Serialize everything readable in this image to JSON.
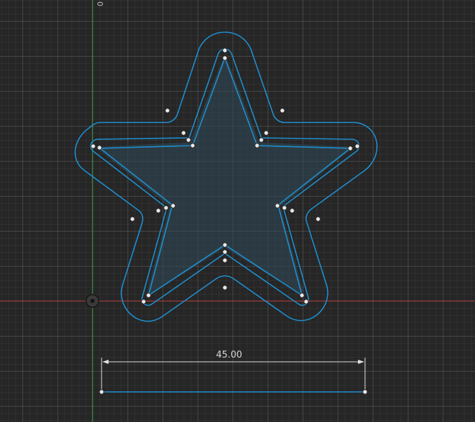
{
  "viewport": {
    "origin_label": "0",
    "colors": {
      "background": "#262626",
      "sketch_line": "#1e8fd0",
      "star_fill": "#2f4a5a",
      "axis_x": "#b03030",
      "axis_y": "#2e9e3a",
      "point": "#e8e8e8",
      "dimension": "#e0e0e0"
    }
  },
  "dimension": {
    "value": "45.00"
  },
  "icons": {
    "origin_marker": "origin-icon",
    "sketch_point": "sketch-point-icon"
  }
}
